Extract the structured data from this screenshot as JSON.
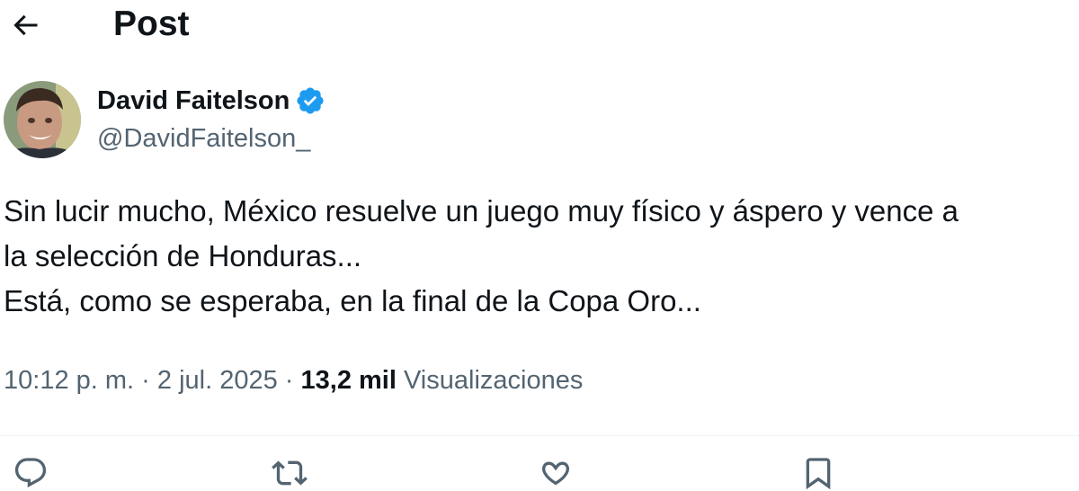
{
  "header": {
    "back_icon": "arrow-left-icon",
    "title": "Post"
  },
  "author": {
    "avatar_icon": "avatar",
    "display_name": "David Faitelson",
    "verified_icon": "verified-badge-icon",
    "verified_color": "#1d9bf0",
    "handle": "@DavidFaitelson_"
  },
  "post": {
    "lines": [
      "Sin lucir mucho, México resuelve un juego muy físico y áspero y vence a",
      "la selección de Honduras...",
      "Está, como se esperaba, en la final de la Copa Oro..."
    ]
  },
  "meta": {
    "time": "10:12 p. m.",
    "separator": "·",
    "date": "2 jul. 2025",
    "views_count": "13,2 mil",
    "views_label": "Visualizaciones"
  },
  "actions": [
    {
      "name": "reply",
      "icon": "reply-icon"
    },
    {
      "name": "repost",
      "icon": "repost-icon"
    },
    {
      "name": "like",
      "icon": "heart-icon"
    },
    {
      "name": "bookmark",
      "icon": "bookmark-icon"
    }
  ],
  "colors": {
    "text_primary": "#0f1419",
    "text_secondary": "#536471",
    "accent": "#1d9bf0",
    "divider": "#eff3f4"
  }
}
